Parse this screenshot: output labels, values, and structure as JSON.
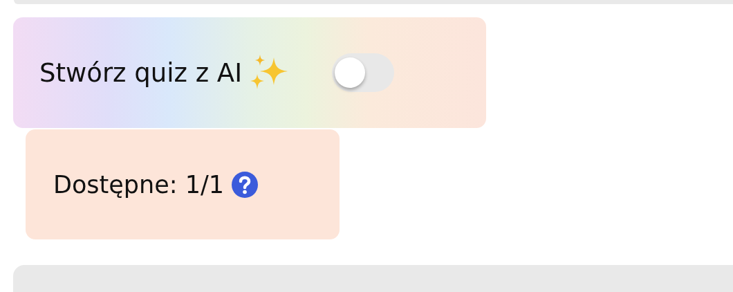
{
  "ai_quiz": {
    "label": "Stwórz quiz z AI",
    "toggle": {
      "on": false
    }
  },
  "availability": {
    "label": "Dostępne: 1/1"
  }
}
